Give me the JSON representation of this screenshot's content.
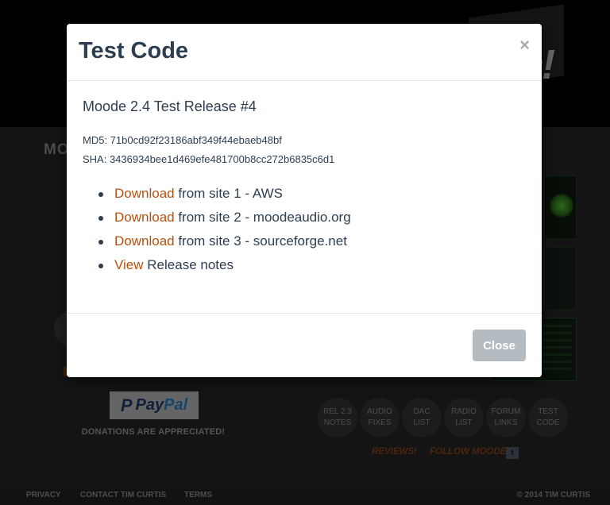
{
  "background": {
    "logo_text": "c!",
    "title": "MO",
    "donations": "DONATIONS ARE APPRECIATED!",
    "paypal": {
      "p": "P",
      "pay": "Pay",
      "pal": "Pal"
    },
    "circle_links": [
      {
        "line1": "REL 2.3",
        "line2": "NOTES"
      },
      {
        "line1": "AUDIO",
        "line2": "FIXES"
      },
      {
        "line1": "DAC",
        "line2": "LIST"
      },
      {
        "line1": "RADIO",
        "line2": "LIST"
      },
      {
        "line1": "FORUM",
        "line2": "LINKS"
      },
      {
        "line1": "TEST",
        "line2": "CODE"
      }
    ],
    "reviews": "REVIEWS!",
    "follow": "FOLLOW MOODE",
    "twitter_glyph": "t",
    "footer": {
      "privacy": "PRIVACY",
      "contact": "CONTACT TIM CURTIS",
      "terms": "TERMS",
      "copyright": "© 2014 TIM CURTIS"
    }
  },
  "modal": {
    "title": "Test Code",
    "close_glyph": "×",
    "release_title": "Moode 2.4 Test Release #4",
    "md5": "MD5: 71b0cd92f23186abf349f44ebaeb48bf",
    "sha": "SHA: 3436934bee1d469efe481700b8cc272b6835c6d1",
    "links": [
      {
        "link": "Download",
        "text": " from site 1 - AWS"
      },
      {
        "link": "Download",
        "text": " from site 2 - moodeaudio.org"
      },
      {
        "link": "Download",
        "text": " from site 3 - sourceforge.net"
      },
      {
        "link": "View",
        "text": " Release notes"
      }
    ],
    "close_button": "Close"
  },
  "colors": {
    "link": "#b5520f",
    "title_text": "#2c3e50",
    "close_button_bg": "#b4bcc2"
  }
}
